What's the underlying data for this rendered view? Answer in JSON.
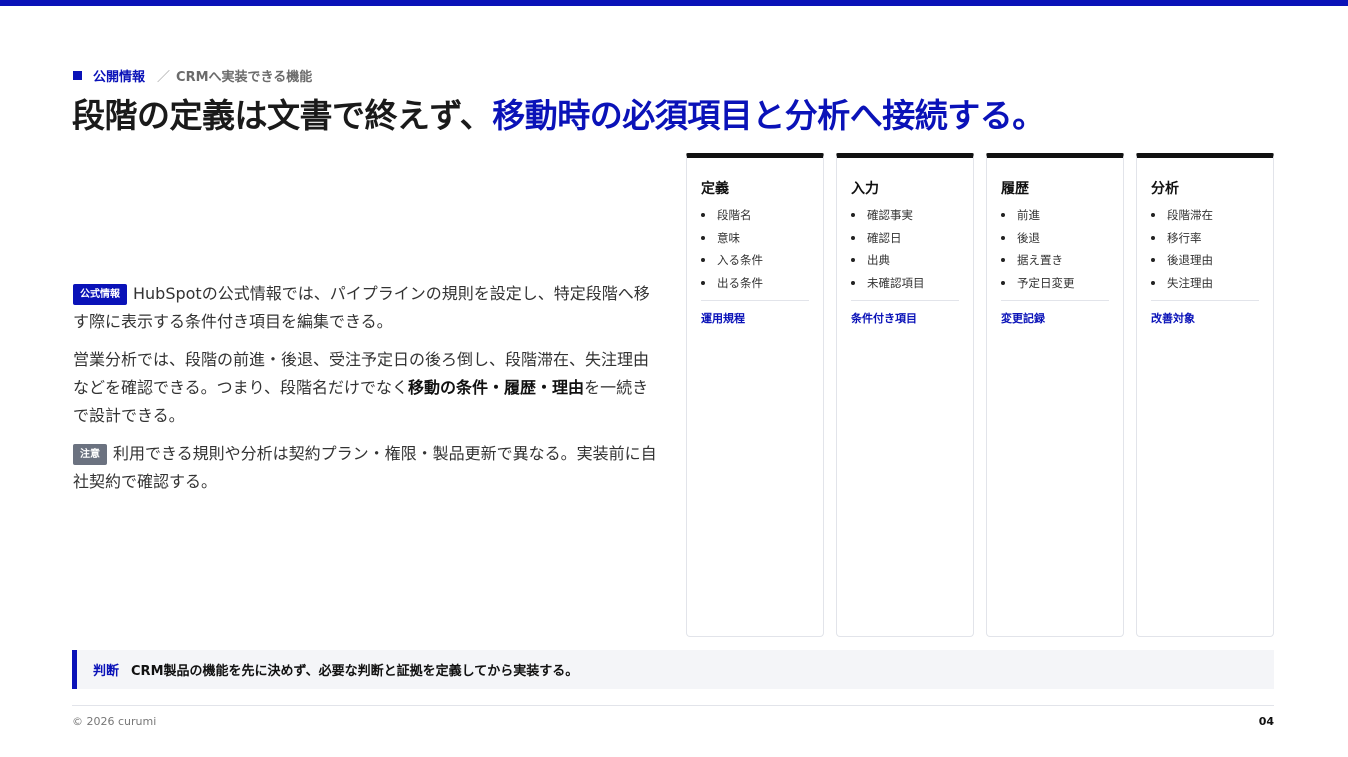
{
  "colors": {
    "accent": "#0a12b8",
    "caution": "#6b7280"
  },
  "breadcrumb": {
    "main": "公開情報",
    "separator": "／",
    "sub": "CRMへ実装できる機能"
  },
  "title": {
    "plain": "段階の定義は文書で終えず、",
    "accent": "移動時の必須項目と分析へ接続する。"
  },
  "body": {
    "p1_badge": "公式情報",
    "p1_text": "HubSpotの公式情報では、パイプラインの規則を設定し、特定段階へ移す際に表示する条件付き項目を編集できる。",
    "p2_text_a": "営業分析では、段階の前進・後退、受注予定日の後ろ倒し、段階滞在、失注理由などを確認できる。つまり、段階名だけでなく",
    "p2_strong": "移動の条件・履歴・理由",
    "p2_text_b": "を一続きで設計できる。",
    "p3_badge": "注意",
    "p3_text": "利用できる規則や分析は契約プラン・権限・製品更新で異なる。実装前に自社契約で確認する。"
  },
  "cards": [
    {
      "title": "定義",
      "items": [
        "段階名",
        "意味",
        "入る条件",
        "出る条件"
      ],
      "footer": "運用規程"
    },
    {
      "title": "入力",
      "items": [
        "確認事実",
        "確認日",
        "出典",
        "未確認項目"
      ],
      "footer": "条件付き項目"
    },
    {
      "title": "履歴",
      "items": [
        "前進",
        "後退",
        "据え置き",
        "予定日変更"
      ],
      "footer": "変更記録"
    },
    {
      "title": "分析",
      "items": [
        "段階滞在",
        "移行率",
        "後退理由",
        "失注理由"
      ],
      "footer": "改善対象"
    }
  ],
  "judgement": {
    "label": "判断",
    "text": "CRM製品の機能を先に決めず、必要な判断と証拠を定義してから実装する。"
  },
  "footer": {
    "copyright": "© 2026 curumi",
    "page": "04"
  }
}
